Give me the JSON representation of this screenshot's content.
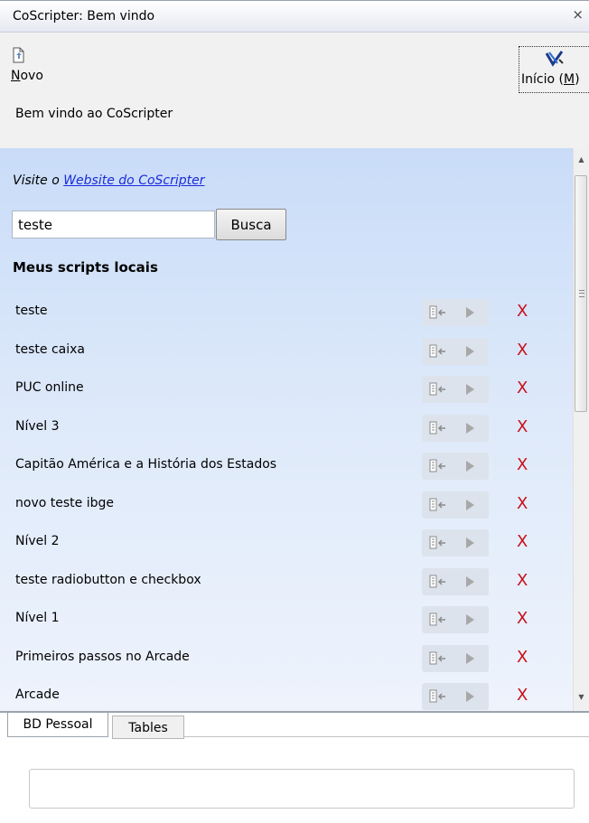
{
  "window": {
    "title": "CoScripter: Bem vindo",
    "close_symbol": "×"
  },
  "toolbar": {
    "new": {
      "label_underlined": "N",
      "label_rest": "ovo",
      "icon": "new-page-icon"
    },
    "home": {
      "label_main": "Início (",
      "label_underlined": "M",
      "label_end": ")",
      "icon": "coscripter-logo-icon"
    }
  },
  "welcome_text": "Bem vindo ao CoScripter",
  "visit": {
    "prefix": "Visite o ",
    "link_text": "Website do CoScripter"
  },
  "search": {
    "value": "teste",
    "button_label": "Busca"
  },
  "section_title": "Meus scripts locais",
  "scripts": [
    {
      "name": "teste"
    },
    {
      "name": "teste caixa"
    },
    {
      "name": "PUC online"
    },
    {
      "name": "Nível 3"
    },
    {
      "name": "Capitão América e a História dos Estados"
    },
    {
      "name": "novo teste ibge"
    },
    {
      "name": "Nível 2"
    },
    {
      "name": "teste radiobutton e checkbox"
    },
    {
      "name": "Nível 1"
    },
    {
      "name": "Primeiros passos no Arcade"
    },
    {
      "name": "Arcade"
    }
  ],
  "delete_symbol": "X",
  "tabs": [
    {
      "label": "BD Pessoal",
      "active": true
    },
    {
      "label": "Tables",
      "active": false
    }
  ],
  "colors": {
    "link": "#1b2bdc",
    "delete": "#c8101a",
    "panel_top": "#c9dcf8",
    "panel_bottom": "#eef3fc"
  }
}
